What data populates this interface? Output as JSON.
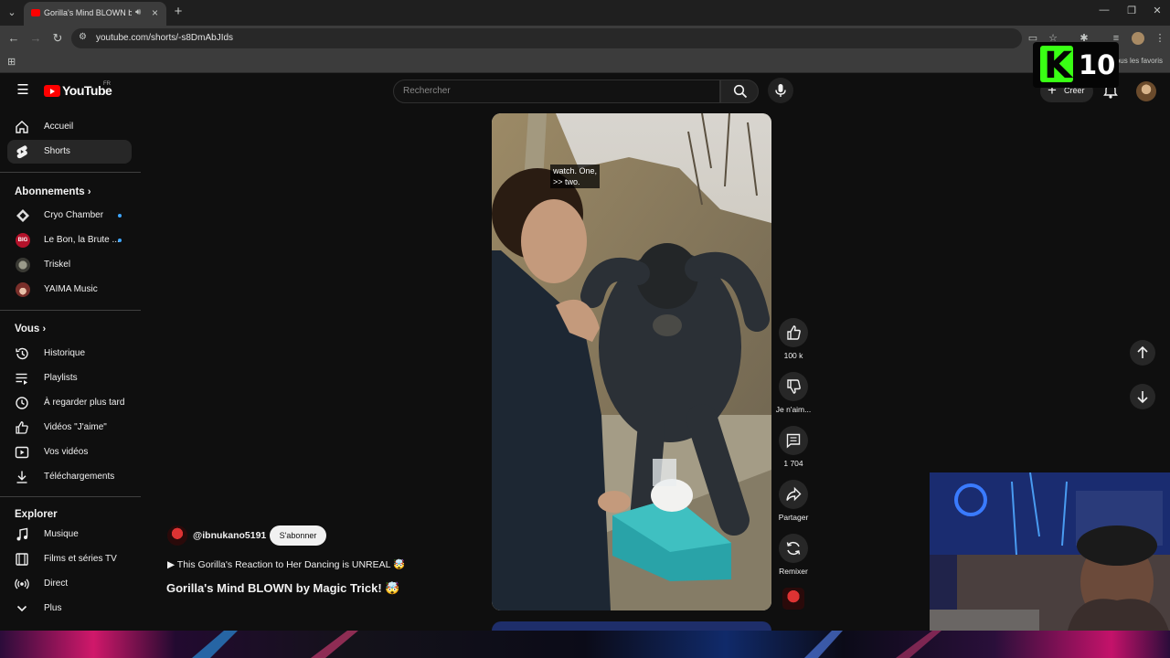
{
  "browser": {
    "tab_title": "Gorilla's Mind BLOWN by Magic Trick! 🤯",
    "url": "youtube.com/shorts/-s8DmAbJIds",
    "bookmarks_all": "Tous les favoris"
  },
  "masthead": {
    "logo_text": "YouTube",
    "country_code": "FR",
    "search_placeholder": "Rechercher",
    "create_label": "Créer"
  },
  "overlay_badge": {
    "letter": "K",
    "number": "10"
  },
  "sidebar": {
    "main": [
      {
        "label": "Accueil",
        "icon": "home-icon"
      },
      {
        "label": "Shorts",
        "icon": "shorts-icon",
        "active": true
      }
    ],
    "subscriptions_heading": "Abonnements",
    "subscriptions": [
      {
        "label": "Cryo Chamber",
        "new": true
      },
      {
        "label": "Le Bon, la Brute ...",
        "new": true
      },
      {
        "label": "Triskel",
        "new": false
      },
      {
        "label": "YAIMA Music",
        "new": false
      }
    ],
    "you_heading": "Vous",
    "you": [
      {
        "label": "Historique",
        "icon": "history-icon"
      },
      {
        "label": "Playlists",
        "icon": "playlists-icon"
      },
      {
        "label": "À regarder plus tard",
        "icon": "watch-later-icon"
      },
      {
        "label": "Vidéos \"J'aime\"",
        "icon": "liked-icon"
      },
      {
        "label": "Vos vidéos",
        "icon": "your-videos-icon"
      },
      {
        "label": "Téléchargements",
        "icon": "downloads-icon"
      }
    ],
    "explore_heading": "Explorer",
    "explore": [
      {
        "label": "Musique",
        "icon": "music-icon"
      },
      {
        "label": "Films et séries TV",
        "icon": "movies-icon"
      },
      {
        "label": "Direct",
        "icon": "live-icon"
      },
      {
        "label": "Plus",
        "icon": "chevron-down-icon"
      }
    ]
  },
  "short": {
    "caption_line1": "watch. One,",
    "caption_line2": ">> two.",
    "channel": "@ibnukano5191",
    "subscribe_label": "S'abonner",
    "playlist_line": "▶ This Gorilla's Reaction to Her Dancing is UNREAL 🤯",
    "title": "Gorilla's Mind BLOWN by Magic Trick! 🤯"
  },
  "actions": {
    "like_count": "100 k",
    "dislike_label": "Je n'aim...",
    "comment_count": "1 704",
    "share_label": "Partager",
    "remix_label": "Remixer"
  },
  "colors": {
    "brand_red": "#ff0000",
    "background": "#0f0f0f",
    "k10_green": "#39ff14",
    "unread_dot": "#3ea6ff"
  }
}
